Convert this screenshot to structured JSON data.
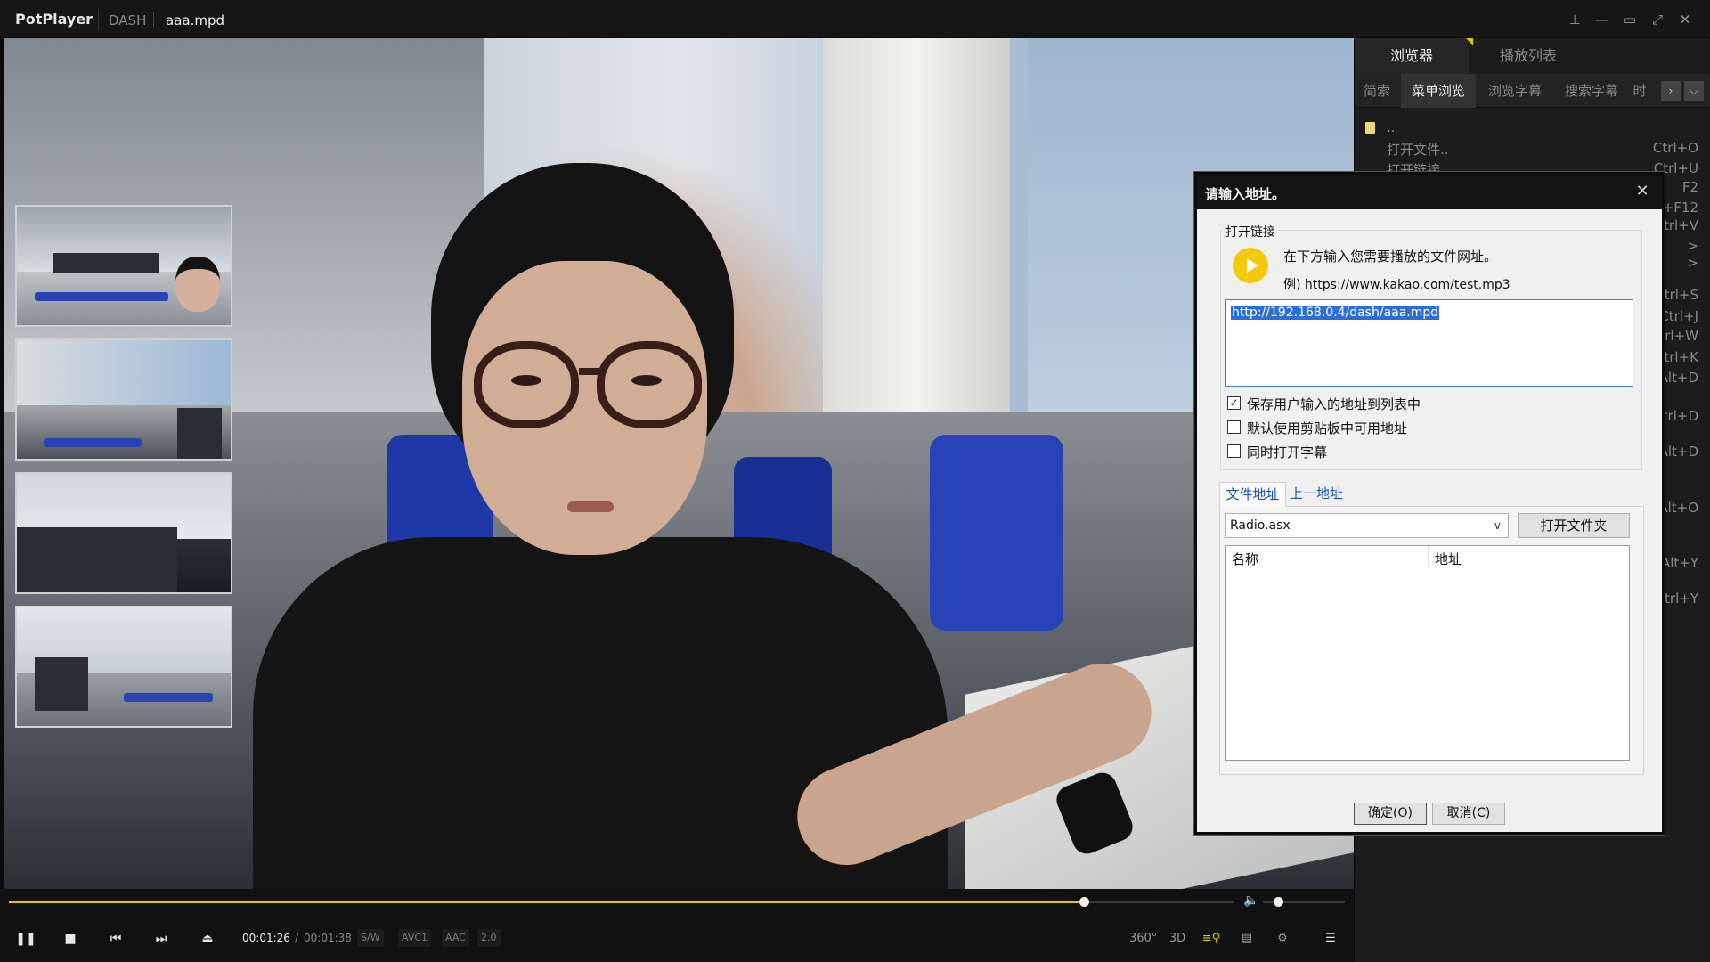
{
  "titlebar": {
    "brand": "PotPlayer",
    "brand_caret": "⌵",
    "protocol": "DASH",
    "filename": "aaa.mpd",
    "buttons": {
      "pin": "⊥",
      "minimize": "—",
      "maximize": "▭",
      "fullscreen": "⤢",
      "close": "✕"
    }
  },
  "player": {
    "current_time": "00:01:26",
    "time_separator": "/",
    "total_time": "00:01:38",
    "progress_fraction": 0.878,
    "volume_fraction": 0.18,
    "badges": [
      "S/W",
      "AVC1",
      "AAC",
      "2.0"
    ],
    "right_controls": {
      "vr": "360°",
      "stereo": "3D"
    },
    "accent_color": "#e7c500"
  },
  "panel": {
    "tabs": [
      {
        "label": "浏览器",
        "active": true
      },
      {
        "label": "播放列表",
        "active": false
      }
    ],
    "subtabs": [
      {
        "label": "简索",
        "active": false
      },
      {
        "label": "菜单浏览",
        "active": true
      },
      {
        "label": "浏览字幕",
        "active": false
      },
      {
        "label": "搜索字幕",
        "active": false
      },
      {
        "label": "时",
        "active": false
      }
    ],
    "up_entry": "..",
    "menu_items": [
      {
        "label": "打开文件..",
        "shortcut": "Ctrl+O"
      },
      {
        "label": "打开链接",
        "shortcut": "Ctrl+U"
      },
      {
        "label": "",
        "shortcut": "F2"
      },
      {
        "label": "",
        "shortcut": "+F12"
      },
      {
        "label": "",
        "shortcut": "trl+V"
      },
      {
        "label": "",
        "shortcut": ">"
      },
      {
        "label": "",
        "shortcut": ">"
      },
      {
        "label": "",
        "shortcut": "trl+S"
      },
      {
        "label": "",
        "shortcut": "Ctrl+J"
      },
      {
        "label": "",
        "shortcut": "rl+W"
      },
      {
        "label": "",
        "shortcut": "trl+K"
      },
      {
        "label": "",
        "shortcut": "Alt+D"
      },
      {
        "label": "",
        "shortcut": "trl+D"
      },
      {
        "label": "",
        "shortcut": "Alt+D"
      },
      {
        "label": "",
        "shortcut": "Alt+O"
      },
      {
        "label": "",
        "shortcut": "Alt+Y"
      },
      {
        "label": "",
        "shortcut": "trl+Y"
      }
    ]
  },
  "dialog": {
    "title": "请输入地址。",
    "close": "✕",
    "group_legend": "打开链接",
    "description": "在下方输入您需要播放的文件网址。",
    "example": "例) https://www.kakao.com/test.mp3",
    "url_value": "http://192.168.0.4/dash/aaa.mpd",
    "options": [
      {
        "label": "保存用户输入的地址到列表中",
        "checked": true
      },
      {
        "label": "默认使用剪贴板中可用地址",
        "checked": false
      },
      {
        "label": "同时打开字幕",
        "checked": false
      }
    ],
    "tab_file": "文件地址",
    "tab_prev": "上一地址",
    "list_select": "Radio.asx",
    "select_caret": "v",
    "open_folder": "打开文件夹",
    "columns": [
      "名称",
      "地址"
    ],
    "ok": "确定(O)",
    "cancel": "取消(C)"
  }
}
